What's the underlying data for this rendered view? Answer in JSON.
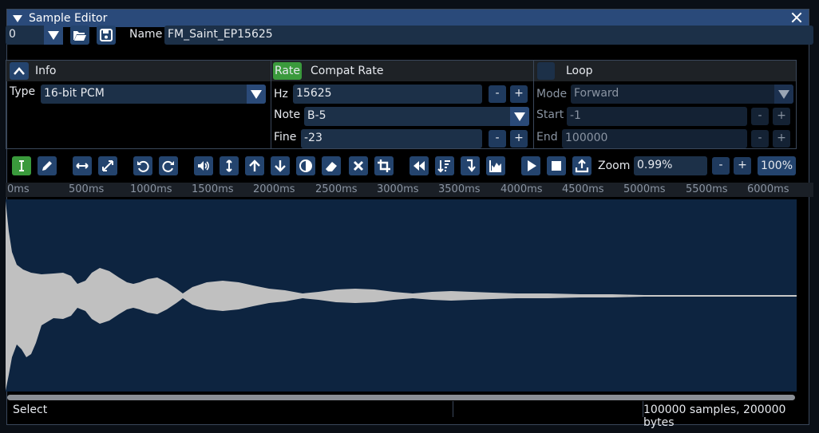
{
  "window": {
    "title": "Sample Editor"
  },
  "top": {
    "sample_index": "0",
    "name_label": "Name",
    "name_value": "FM_Saint_EP15625"
  },
  "info": {
    "header": "Info",
    "type_label": "Type",
    "type_value": "16-bit PCM"
  },
  "rate": {
    "rate_tab": "Rate",
    "compat_tab": "Compat Rate",
    "hz_label": "Hz",
    "hz_value": "15625",
    "note_label": "Note",
    "note_value": "B-5",
    "fine_label": "Fine",
    "fine_value": "-23",
    "minus": "-",
    "plus": "+"
  },
  "loop": {
    "header": "Loop",
    "mode_label": "Mode",
    "mode_value": "Forward",
    "start_label": "Start",
    "start_value": "-1",
    "end_label": "End",
    "end_value": "100000",
    "minus": "-",
    "plus": "+"
  },
  "toolbar": {
    "icons": [
      "select-icon",
      "pencil-icon",
      "resize-horizontal-icon",
      "expand-icon",
      "undo-icon",
      "redo-icon",
      "volume-icon",
      "resize-vertical-icon",
      "arrow-up-icon",
      "arrow-down-icon",
      "invert-icon",
      "eraser-icon",
      "x-icon",
      "crop-icon",
      "rewind-icon",
      "sort-icon",
      "arrow-down-bar-icon",
      "chart-icon",
      "play-icon",
      "stop-icon",
      "upload-icon"
    ],
    "zoom_label": "Zoom",
    "zoom_value": "0.99%",
    "zoom_minus": "-",
    "zoom_plus": "+",
    "zoom_reset": "100%"
  },
  "ruler": {
    "ticks": [
      "0ms",
      "500ms",
      "1000ms",
      "1500ms",
      "2000ms",
      "2500ms",
      "3000ms",
      "3500ms",
      "4000ms",
      "4500ms",
      "5000ms",
      "5500ms",
      "6000ms"
    ]
  },
  "status": {
    "mode": "Select",
    "info": "100000 samples, 200000 bytes"
  },
  "colors": {
    "accent": "#2a4a7a",
    "active": "#3a9a3c",
    "wave_bg": "#0d2440",
    "wave_fill": "#c0c0c0"
  }
}
